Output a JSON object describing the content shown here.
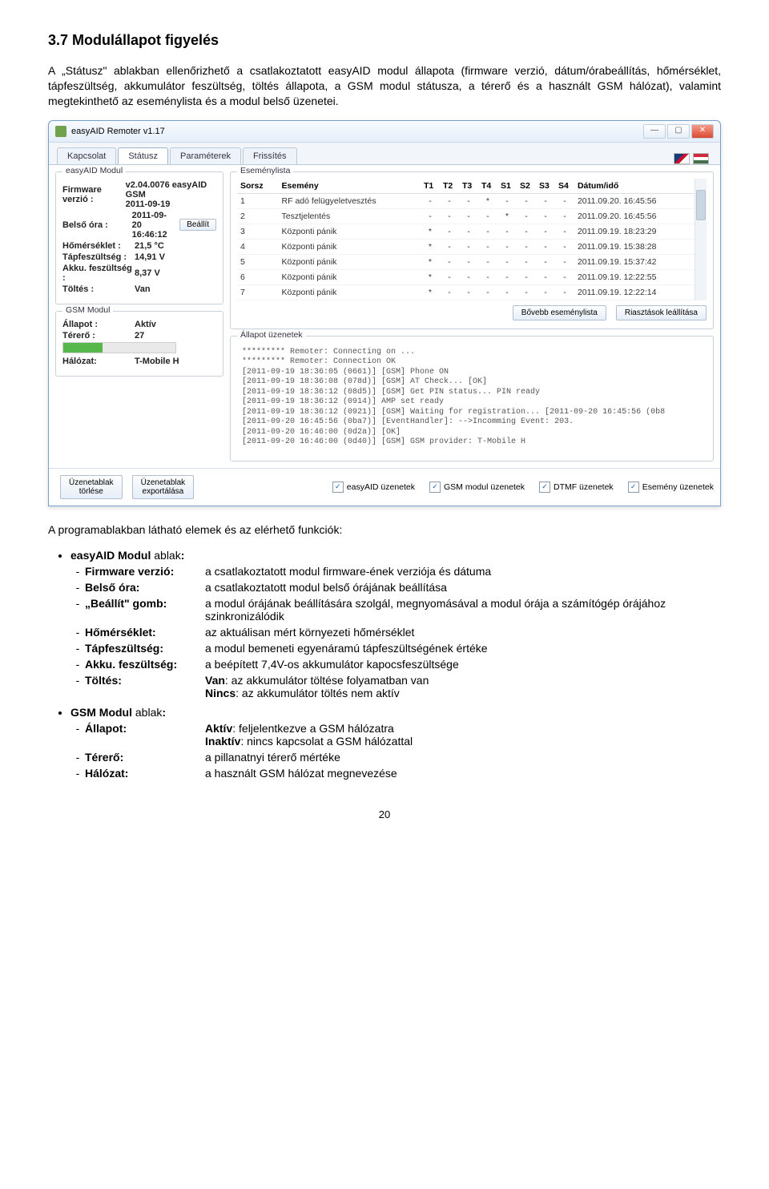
{
  "section_number": "3.7",
  "section_title": "Modulállapot figyelés",
  "para1": "A „Státusz\" ablakban ellenőrizhető a csatlakoztatott easyAID modul állapota (firmware verzió, dátum/órabeállítás, hőmérséklet, tápfeszültség, akkumulátor feszültség, töltés állapota, a GSM modul státusza, a térerő és a használt GSM hálózat), valamint megtekinthető az eseménylista és a modul belső üzenetei.",
  "intro_features": "A programablakban látható elemek és az elérhető funkciók:",
  "window": {
    "title": "easyAID Remoter v1.17",
    "tabs": [
      "Kapcsolat",
      "Státusz",
      "Paraméterek",
      "Frissítés"
    ],
    "active_tab": 1,
    "module_box_title": "easyAID Modul",
    "firmware_label": "Firmware verzió :",
    "firmware_value": "v2.04.0076 easyAID GSM\n2011-09-19",
    "clock_label": "Belső óra :",
    "clock_value": "2011-09-20\n16:46:12",
    "set_btn": "Beállít",
    "temp_label": "Hőmérséklet :",
    "temp_value": "21,5 °C",
    "supply_label": "Tápfeszültség :",
    "supply_value": "14,91 V",
    "akku_label": "Akku. feszültség :",
    "akku_value": "8,37 V",
    "charge_label": "Töltés :",
    "charge_value": "Van",
    "gsm_box_title": "GSM Modul",
    "gsm_state_label": "Állapot :",
    "gsm_state_value": "Aktív",
    "signal_label": "Térerő :",
    "signal_value": "27",
    "network_label": "Hálózat:",
    "network_value": "T-Mobile H",
    "eventlist_title": "Eseménylista",
    "event_headers": [
      "Sorsz",
      "Esemény",
      "T1",
      "T2",
      "T3",
      "T4",
      "S1",
      "S2",
      "S3",
      "S4",
      "Dátum/idő"
    ],
    "events": [
      {
        "n": "1",
        "e": "RF adó felügyeletvesztés",
        "f": [
          "-",
          "-",
          "-",
          "*",
          "-",
          "-",
          "-",
          "-"
        ],
        "d": "2011.09.20. 16:45:56"
      },
      {
        "n": "2",
        "e": "Tesztjelentés",
        "f": [
          "-",
          "-",
          "-",
          "-",
          "*",
          "-",
          "-",
          "-"
        ],
        "d": "2011.09.20. 16:45:56"
      },
      {
        "n": "3",
        "e": "Központi pánik",
        "f": [
          "*",
          "-",
          "-",
          "-",
          "-",
          "-",
          "-",
          "-"
        ],
        "d": "2011.09.19. 18:23:29"
      },
      {
        "n": "4",
        "e": "Központi pánik",
        "f": [
          "*",
          "-",
          "-",
          "-",
          "-",
          "-",
          "-",
          "-"
        ],
        "d": "2011.09.19. 15:38:28"
      },
      {
        "n": "5",
        "e": "Központi pánik",
        "f": [
          "*",
          "-",
          "-",
          "-",
          "-",
          "-",
          "-",
          "-"
        ],
        "d": "2011.09.19. 15:37:42"
      },
      {
        "n": "6",
        "e": "Központi pánik",
        "f": [
          "*",
          "-",
          "-",
          "-",
          "-",
          "-",
          "-",
          "-"
        ],
        "d": "2011.09.19. 12:22:55"
      },
      {
        "n": "7",
        "e": "Központi pánik",
        "f": [
          "*",
          "-",
          "-",
          "-",
          "-",
          "-",
          "-",
          "-"
        ],
        "d": "2011.09.19. 12:22:14"
      }
    ],
    "more_events_btn": "Bővebb eseménylista",
    "stop_alarms_btn": "Riasztások leállítása",
    "status_box_title": "Állapot üzenetek",
    "status_text": "********* Remoter: Connecting on ...\n********* Remoter: Connection OK\n[2011-09-19 18:36:05 (0661)] [GSM] Phone ON\n[2011-09-19 18:36:08 (078d)] [GSM] AT Check... [OK]\n[2011-09-19 18:36:12 (08d5)] [GSM] Get PIN status... PIN ready\n[2011-09-19 18:36:12 (0914)] AMP set ready\n[2011-09-19 18:36:12 (0921)] [GSM] Waiting for registration... [2011-09-20 16:45:56 (0b8\n[2011-09-20 16:45:56 (0ba7)] [EventHandler]: -->Incomming Event: 203.\n[2011-09-20 16:46:00 (0d2a)] [OK]\n[2011-09-20 16:46:00 (0d40)] [GSM] GSM provider: T-Mobile H",
    "footer_btn1": "Üzenetablak\ntörlése",
    "footer_btn2": "Üzenetablak\nexportálása",
    "chk1": "easyAID üzenetek",
    "chk2": "GSM modul üzenetek",
    "chk3": "DTMF üzenetek",
    "chk4": "Esemény üzenetek"
  },
  "blocks": [
    {
      "title": "easyAID Modul ablak:",
      "rows": [
        {
          "term": "Firmware verzió:",
          "desc": "a csatlakoztatott modul firmware-ének verziója és dátuma"
        },
        {
          "term": "Belső óra:",
          "desc": "a csatlakoztatott modul belső órájának beállítása"
        },
        {
          "term": "„Beállít\" gomb:",
          "desc": "a modul órájának beállítására szolgál, megnyomásával a modul órája a számítógép órájához szinkronizálódik"
        },
        {
          "term": "Hőmérséklet:",
          "desc": "az aktuálisan mért környezeti hőmérséklet"
        },
        {
          "term": "Tápfeszültség:",
          "desc": "a modul bemeneti egyenáramú tápfeszültségének értéke"
        },
        {
          "term": "Akku. feszültség:",
          "desc": "a beépített 7,4V-os akkumulátor kapocsfeszültsége"
        },
        {
          "term": "Töltés:",
          "desc": "Van: az akkumulátor töltése folyamatban van\nNincs:   az akkumulátor töltés nem aktív"
        }
      ]
    },
    {
      "title": "GSM Modul ablak:",
      "rows": [
        {
          "term": "Állapot:",
          "desc": "Aktív: feljelentkezve a GSM hálózatra\nInaktív: nincs kapcsolat a GSM hálózattal"
        },
        {
          "term": "Térerő:",
          "desc": "a pillanatnyi térerő mértéke"
        },
        {
          "term": "Hálózat:",
          "desc": "a használt GSM hálózat megnevezése"
        }
      ]
    }
  ],
  "page_number": "20"
}
